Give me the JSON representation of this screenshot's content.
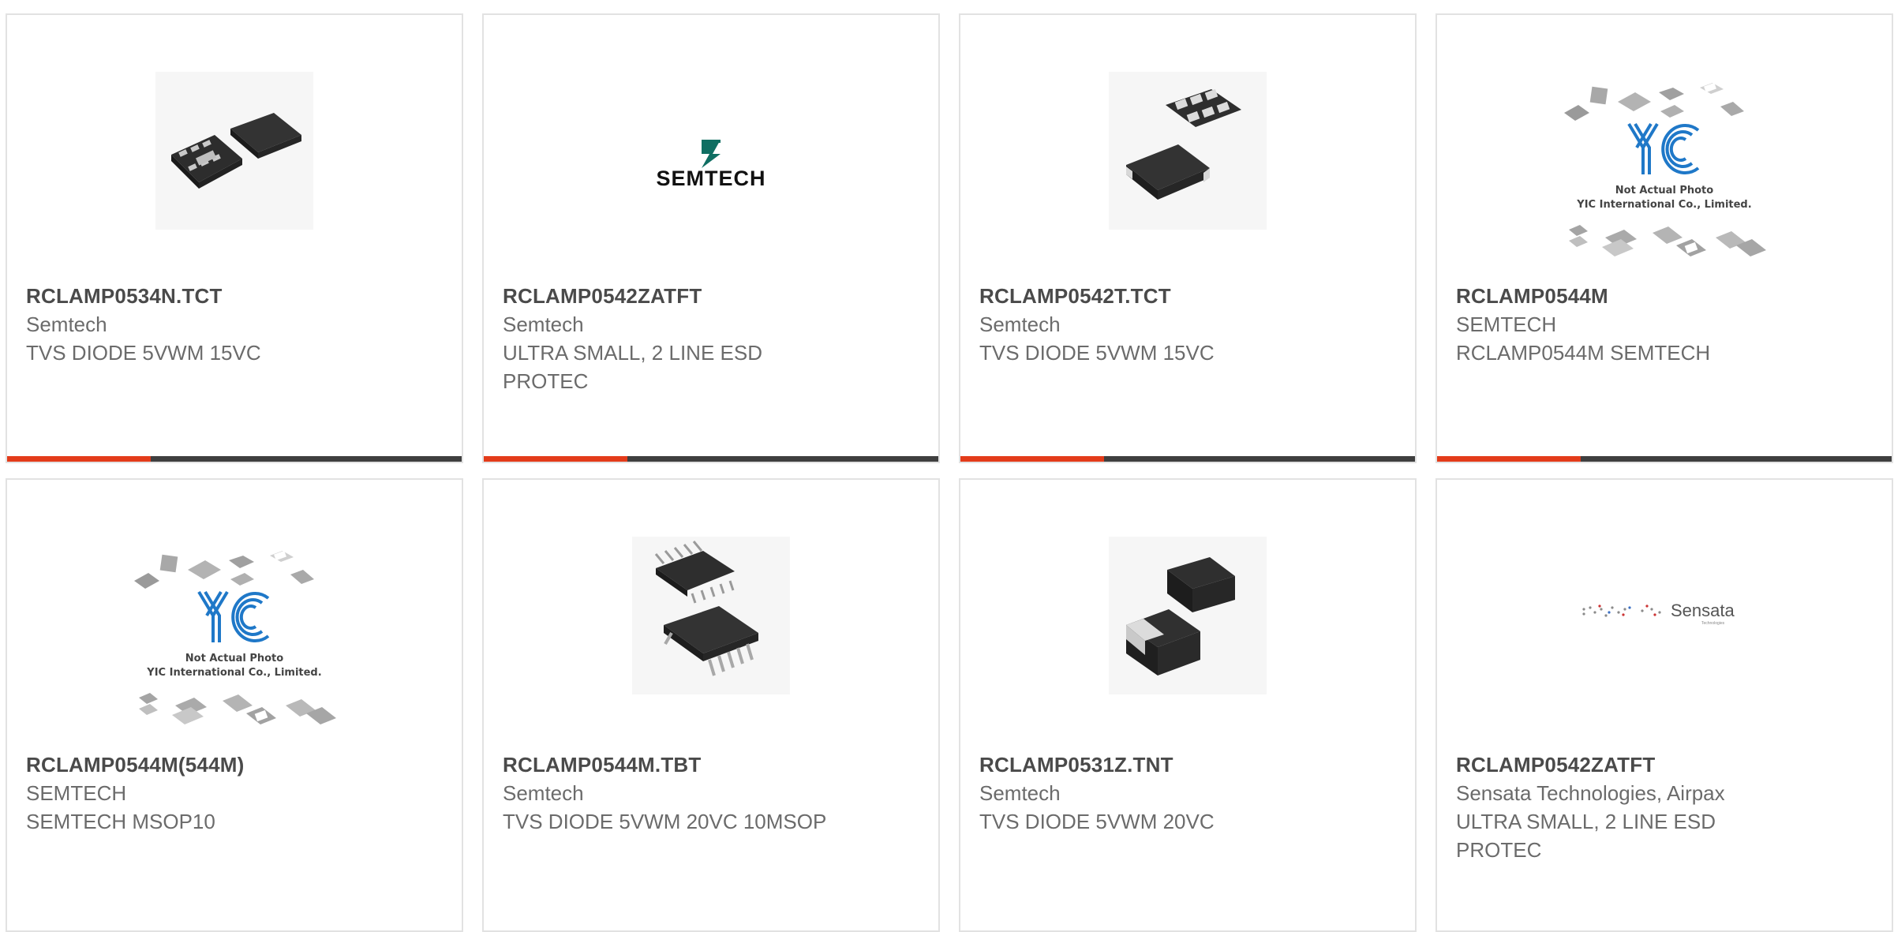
{
  "products": [
    {
      "part": "RCLAMP0534N.TCT",
      "maker": "Semtech",
      "desc": "TVS DIODE 5VWM 15VC",
      "image": "chip-dfn-package"
    },
    {
      "part": "RCLAMP0542ZATFT",
      "maker": "Semtech",
      "desc": "ULTRA SMALL, 2 LINE ESD PROTEC",
      "image": "semtech-logo",
      "logo_text": "SEMTECH"
    },
    {
      "part": "RCLAMP0542T.TCT",
      "maker": "Semtech",
      "desc": "TVS DIODE 5VWM 15VC",
      "image": "chip-slp-package"
    },
    {
      "part": "RCLAMP0544M",
      "maker": "SEMTECH",
      "desc": "RCLAMP0544M SEMTECH",
      "image": "yic-placeholder",
      "placeholder_line1": "Not Actual Photo",
      "placeholder_line2": "YIC International Co., Limited."
    },
    {
      "part": "RCLAMP0544M(544M)",
      "maker": "SEMTECH",
      "desc": "SEMTECH MSOP10",
      "image": "yic-placeholder",
      "placeholder_line1": "Not Actual Photo",
      "placeholder_line2": "YIC International Co., Limited."
    },
    {
      "part": "RCLAMP0544M.TBT",
      "maker": "Semtech",
      "desc": "TVS DIODE 5VWM 20VC 10MSOP",
      "image": "chip-msop-package"
    },
    {
      "part": "RCLAMP0531Z.TNT",
      "maker": "Semtech",
      "desc": "TVS DIODE 5VWM 20VC",
      "image": "chip-sod-package"
    },
    {
      "part": "RCLAMP0542ZATFT",
      "maker": "Sensata Technologies, Airpax",
      "desc": "ULTRA SMALL, 2 LINE ESD PROTEC",
      "image": "sensata-logo",
      "logo_text": "Sensata",
      "logo_subtext": "Technologies"
    }
  ],
  "colors": {
    "accent": "#e33b1a",
    "bar": "#3f3f3f",
    "border": "#e2e2e2",
    "yic_blue": "#1f78c8"
  }
}
